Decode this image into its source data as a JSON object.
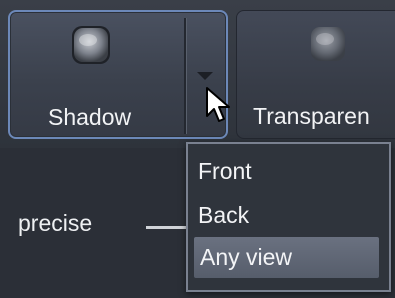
{
  "toolbar": {
    "shadow_button": {
      "label": "Shadow",
      "icon": "cube-icon"
    },
    "shadow_dropdown": {
      "icon": "chevron-down-icon"
    },
    "transparency_button": {
      "label": "Transparen",
      "icon": "cube-icon"
    }
  },
  "quality": {
    "label": "precise"
  },
  "menu": {
    "items": [
      {
        "label": "Front"
      },
      {
        "label": "Back"
      },
      {
        "label": "Any view",
        "selected": true
      }
    ]
  },
  "colors": {
    "focus_border": "#6c88b8",
    "selected_item": "#626979",
    "background": "#2a2e35"
  }
}
